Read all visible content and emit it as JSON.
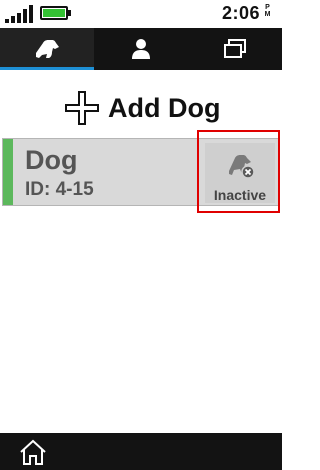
{
  "status_bar": {
    "time": "2:06",
    "ampm_top": "P",
    "ampm_bottom": "M",
    "signal_icon": "cellular-signal-icon",
    "battery_icon": "battery-icon",
    "battery_color": "#33c233"
  },
  "tabs": [
    {
      "icon": "dog-icon",
      "active": true
    },
    {
      "icon": "person-icon",
      "active": false
    },
    {
      "icon": "stacked-windows-icon",
      "active": false
    }
  ],
  "accent_color": "#1e90d6",
  "add_dog": {
    "label": "Add Dog",
    "icon": "plus-icon"
  },
  "dogs": [
    {
      "name": "Dog",
      "id_text": "ID: 4-15",
      "status_label": "Inactive",
      "status_icon": "inactive-dog-icon",
      "indicator_color": "#5cb85c"
    }
  ],
  "bottom_bar": {
    "home_icon": "home-icon"
  },
  "highlight_color": "#e00000"
}
